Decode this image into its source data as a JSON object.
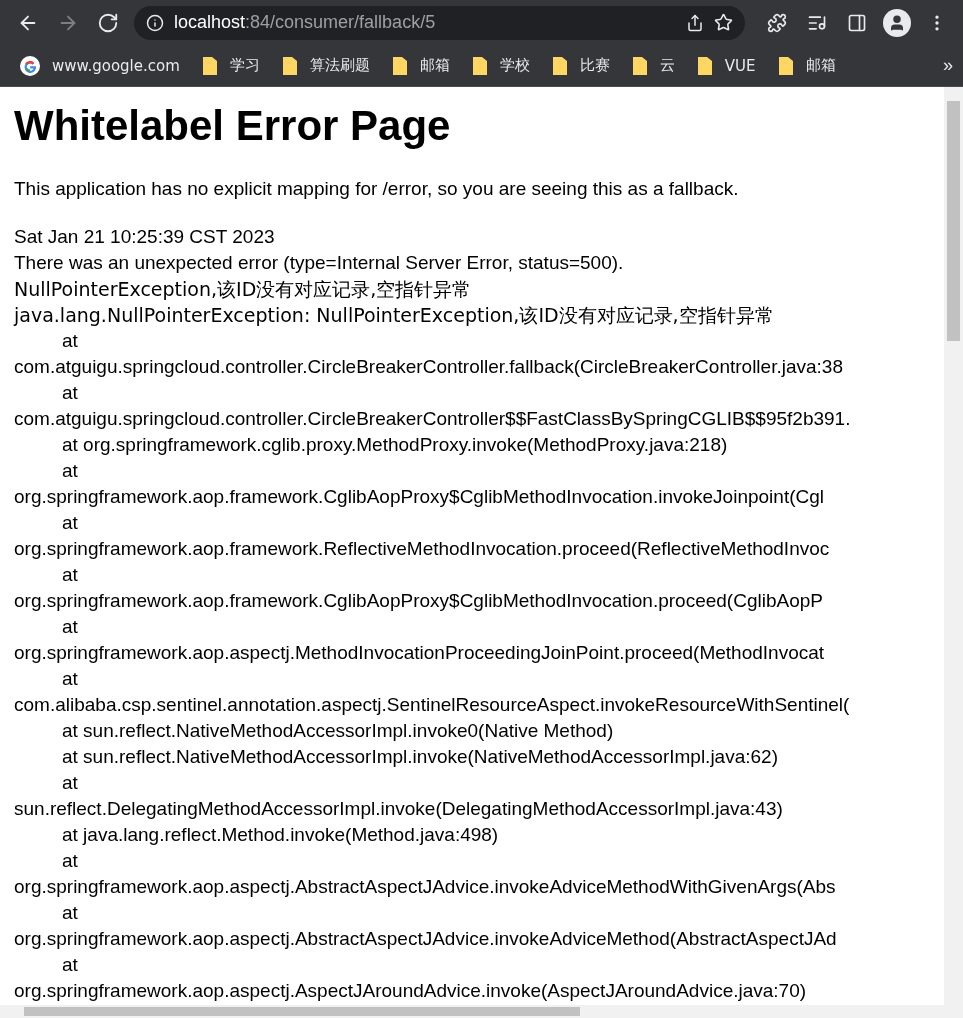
{
  "toolbar": {
    "nav": [
      {
        "kind": "back",
        "disabled": false
      },
      {
        "kind": "forward",
        "disabled": true
      },
      {
        "kind": "reload",
        "disabled": false
      }
    ],
    "address": {
      "host": "localhost",
      "path": ":84/consumer/fallback/5"
    },
    "bookmarked": false
  },
  "bookmarks": [
    {
      "kind": "site",
      "label": "www.google.com"
    },
    {
      "kind": "folder",
      "label": "学习"
    },
    {
      "kind": "folder",
      "label": "算法刷题"
    },
    {
      "kind": "folder",
      "label": "邮箱"
    },
    {
      "kind": "folder",
      "label": "学校"
    },
    {
      "kind": "folder",
      "label": "比赛"
    },
    {
      "kind": "folder",
      "label": "云"
    },
    {
      "kind": "folder",
      "label": "VUE"
    },
    {
      "kind": "folder",
      "label": "邮箱"
    }
  ],
  "bookmarks_overflow": "»",
  "page": {
    "title": "Whitelabel Error Page",
    "intro": "This application has no explicit mapping for /error, so you are seeing this as a fallback.",
    "lines": [
      {
        "indented": false,
        "text": "Sat Jan 21 10:25:39 CST 2023"
      },
      {
        "indented": false,
        "text": "There was an unexpected error (type=Internal Server Error, status=500)."
      },
      {
        "indented": false,
        "text": "NullPointerException,该ID没有对应记录,空指针异常"
      },
      {
        "indented": false,
        "text": "java.lang.NullPointerException: NullPointerException,该ID没有对应记录,空指针异常"
      },
      {
        "indented": true,
        "text": "at"
      },
      {
        "indented": false,
        "text": "com.atguigu.springcloud.controller.CircleBreakerController.fallback(CircleBreakerController.java:38"
      },
      {
        "indented": true,
        "text": "at"
      },
      {
        "indented": false,
        "text": "com.atguigu.springcloud.controller.CircleBreakerController$$FastClassBySpringCGLIB$$95f2b391."
      },
      {
        "indented": true,
        "text": "at org.springframework.cglib.proxy.MethodProxy.invoke(MethodProxy.java:218)"
      },
      {
        "indented": true,
        "text": "at"
      },
      {
        "indented": false,
        "text": "org.springframework.aop.framework.CglibAopProxy$CglibMethodInvocation.invokeJoinpoint(Cgl"
      },
      {
        "indented": true,
        "text": "at"
      },
      {
        "indented": false,
        "text": "org.springframework.aop.framework.ReflectiveMethodInvocation.proceed(ReflectiveMethodInvoc"
      },
      {
        "indented": true,
        "text": "at"
      },
      {
        "indented": false,
        "text": "org.springframework.aop.framework.CglibAopProxy$CglibMethodInvocation.proceed(CglibAopP"
      },
      {
        "indented": true,
        "text": "at"
      },
      {
        "indented": false,
        "text": "org.springframework.aop.aspectj.MethodInvocationProceedingJoinPoint.proceed(MethodInvocat"
      },
      {
        "indented": true,
        "text": "at"
      },
      {
        "indented": false,
        "text": "com.alibaba.csp.sentinel.annotation.aspectj.SentinelResourceAspect.invokeResourceWithSentinel("
      },
      {
        "indented": true,
        "text": "at sun.reflect.NativeMethodAccessorImpl.invoke0(Native Method)"
      },
      {
        "indented": true,
        "text": "at sun.reflect.NativeMethodAccessorImpl.invoke(NativeMethodAccessorImpl.java:62)"
      },
      {
        "indented": true,
        "text": "at"
      },
      {
        "indented": false,
        "text": "sun.reflect.DelegatingMethodAccessorImpl.invoke(DelegatingMethodAccessorImpl.java:43)"
      },
      {
        "indented": true,
        "text": "at java.lang.reflect.Method.invoke(Method.java:498)"
      },
      {
        "indented": true,
        "text": "at"
      },
      {
        "indented": false,
        "text": "org.springframework.aop.aspectj.AbstractAspectJAdvice.invokeAdviceMethodWithGivenArgs(Abs"
      },
      {
        "indented": true,
        "text": "at"
      },
      {
        "indented": false,
        "text": "org.springframework.aop.aspectj.AbstractAspectJAdvice.invokeAdviceMethod(AbstractAspectJAd"
      },
      {
        "indented": true,
        "text": "at"
      },
      {
        "indented": false,
        "text": "org.springframework.aop.aspectj.AspectJAroundAdvice.invoke(AspectJAroundAdvice.java:70)"
      }
    ]
  }
}
